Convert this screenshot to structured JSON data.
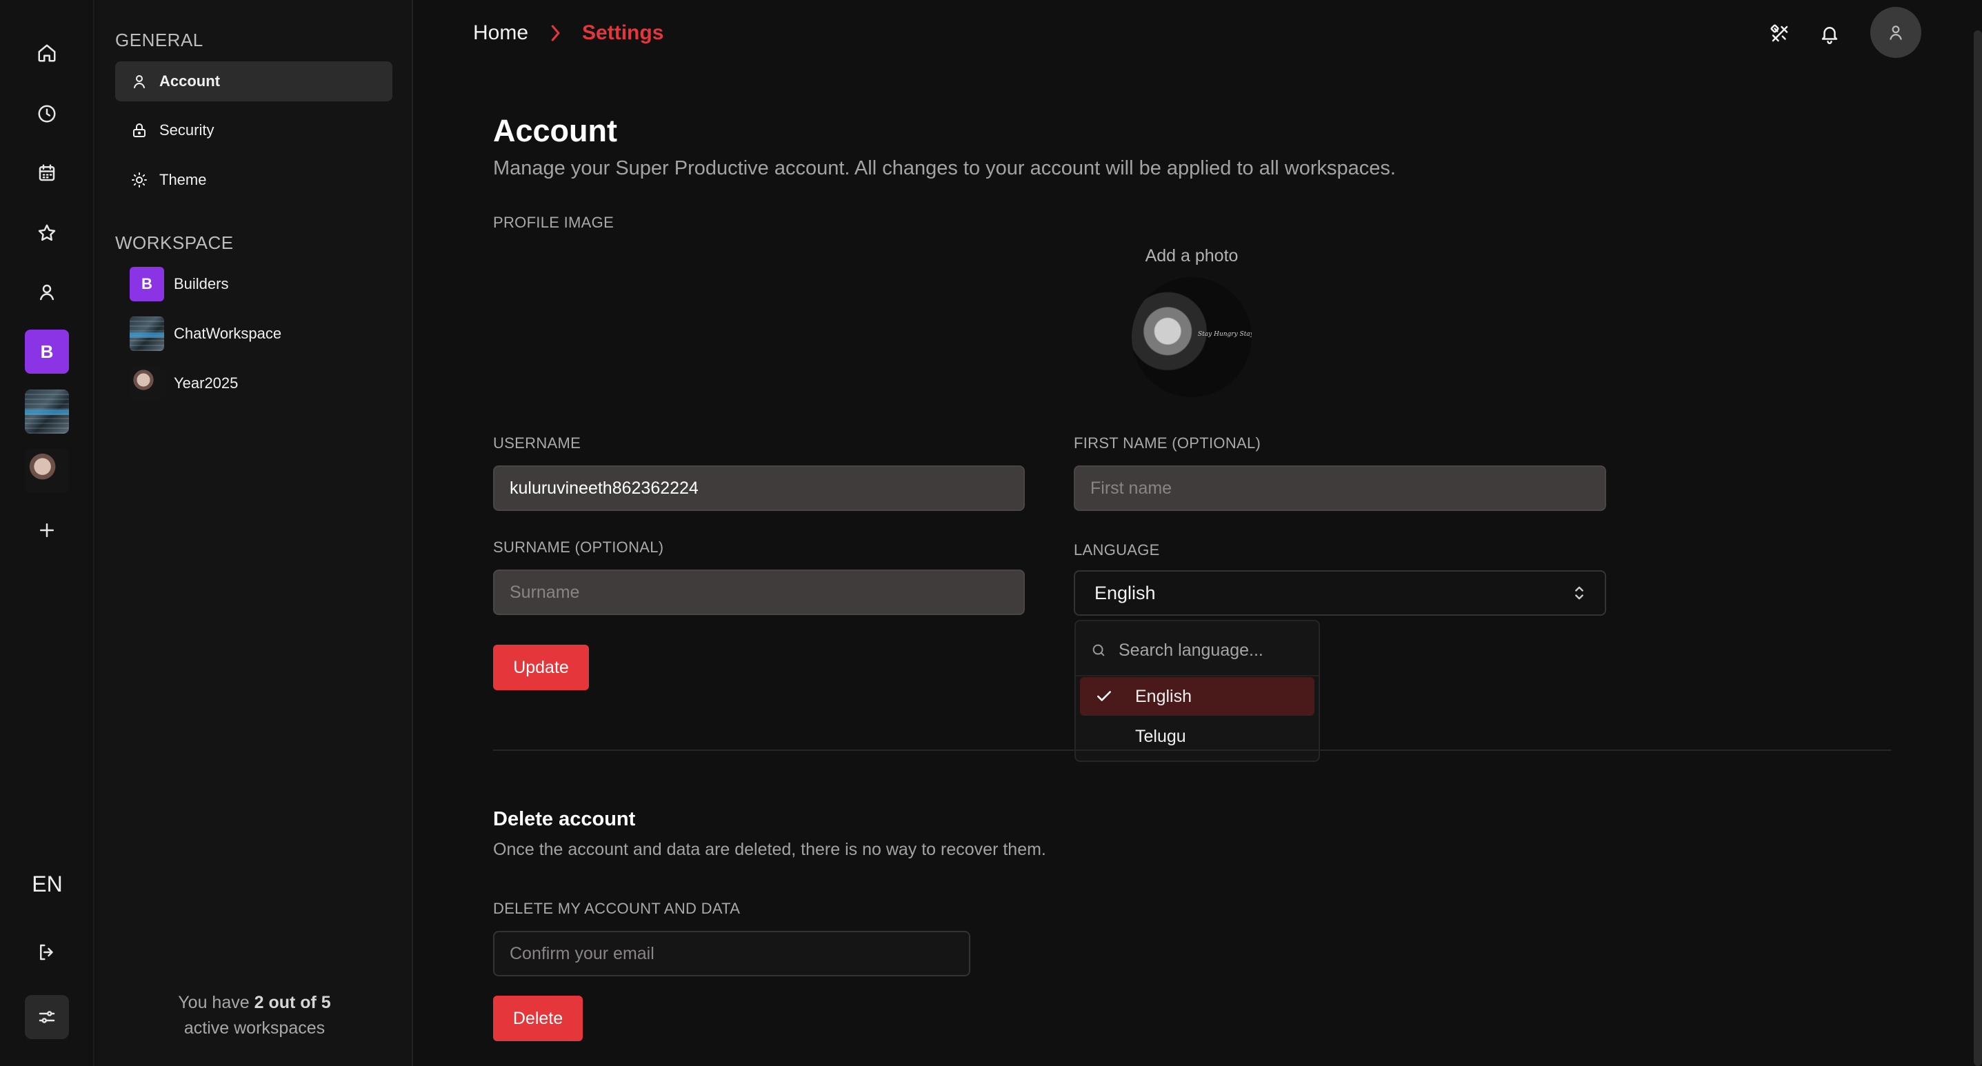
{
  "rail": {
    "language": "EN",
    "workspace_b_initial": "B"
  },
  "nav": {
    "general_heading": "GENERAL",
    "items": [
      {
        "label": "Account"
      },
      {
        "label": "Security"
      },
      {
        "label": "Theme"
      }
    ],
    "workspace_heading": "WORKSPACE",
    "workspaces": [
      {
        "label": "Builders",
        "initial": "B"
      },
      {
        "label": "ChatWorkspace"
      },
      {
        "label": "Year2025"
      }
    ],
    "footer": {
      "prefix": "You have",
      "count": "2 out of 5",
      "suffix": "active workspaces"
    }
  },
  "breadcrumb": {
    "home": "Home",
    "current": "Settings"
  },
  "account": {
    "title": "Account",
    "subtitle": "Manage your Super Productive account. All changes to your account will be applied to all workspaces.",
    "profile_image_label": "PROFILE IMAGE",
    "add_photo": "Add a photo",
    "username_label": "USERNAME",
    "username_value": "kuluruvineeth862362224",
    "first_name_label": "FIRST NAME (OPTIONAL)",
    "first_name_placeholder": "First name",
    "surname_label": "SURNAME (OPTIONAL)",
    "surname_placeholder": "Surname",
    "language_label": "LANGUAGE",
    "language_value": "English",
    "update_button": "Update"
  },
  "language_dropdown": {
    "search_placeholder": "Search language...",
    "options": [
      {
        "label": "English",
        "selected": true
      },
      {
        "label": "Telugu",
        "selected": false
      }
    ]
  },
  "delete_account": {
    "title": "Delete account",
    "description": "Once the account and data are deleted, there is no way to recover them.",
    "field_label": "DELETE MY ACCOUNT AND DATA",
    "email_placeholder": "Confirm your email",
    "delete_button": "Delete"
  },
  "colors": {
    "accent": "#e5373b",
    "workspace_purple": "#8b34e6",
    "background": "#101010"
  }
}
